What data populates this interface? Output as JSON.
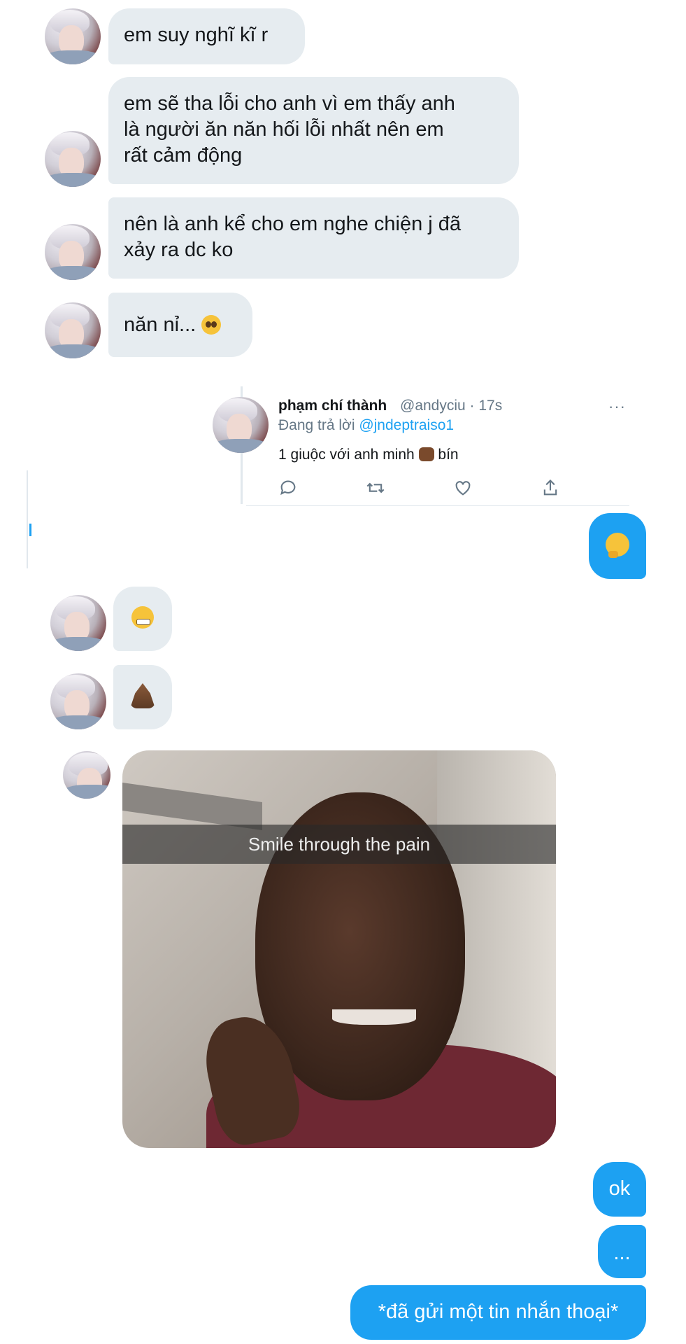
{
  "messages_in": [
    {
      "text": "em suy nghĩ kĩ r"
    },
    {
      "lines": [
        "em sẽ tha lỗi cho anh vì em thấy anh",
        "là người ăn năn hối lỗi nhất nên em",
        "rất cảm động"
      ]
    },
    {
      "lines": [
        "nên là anh kể cho em nghe chiện j đã",
        "xảy ra dc ko"
      ]
    },
    {
      "text": "năn nỉ...",
      "emoji": "pleading-face"
    },
    {
      "emoji": "grimacing-face"
    },
    {
      "emoji": "folded-hands"
    }
  ],
  "quoted_tweet": {
    "name": "phạm chí thành",
    "handle_time": "@andyciu · 17s",
    "reply_prefix": "Đang trả lời",
    "reply_handle": "@jndeptraiso1",
    "body_before": "1 giuộc với anh minh",
    "body_after": "bín",
    "more": "···",
    "actions": [
      "reply-icon",
      "retweet-icon",
      "like-icon",
      "share-icon"
    ]
  },
  "messages_out": [
    {
      "emoji": "thinking-face"
    },
    {
      "text": "ok"
    },
    {
      "text": "..."
    },
    {
      "text": "*đã gửi một tin nhắn thoại*"
    }
  ],
  "meme": {
    "caption": "Smile through the pain"
  },
  "colors": {
    "outgoing": "#1da1f2",
    "incoming": "#e6ecf0",
    "link": "#1da1f2"
  }
}
